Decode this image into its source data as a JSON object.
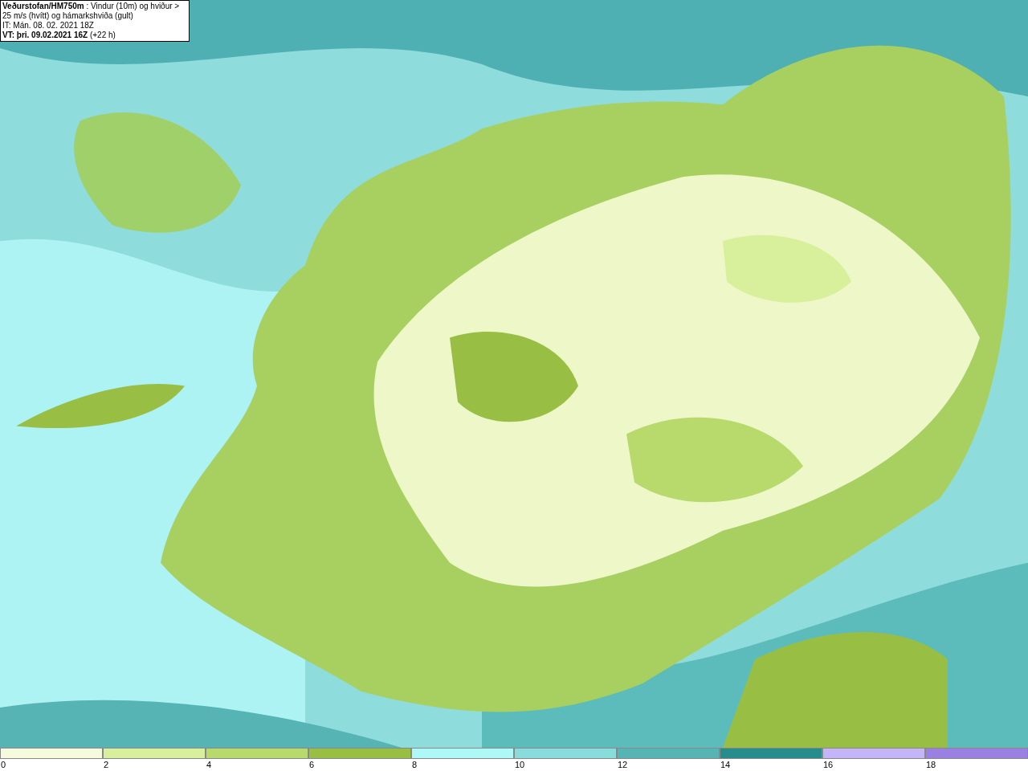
{
  "caption": {
    "heading": "**Veðurstofan/HM750m** : Vindur (10m) og hviður > 25 m/s (hvítt) og hámarkshviða (gult)",
    "initial_time": "IT: Mán. 08. 02. 2021 18Z",
    "valid_time": "**VT: þri. 09.02.2021 16Z** (+22 h)"
  },
  "legend": {
    "bins": [
      {
        "color": "#f5fbdc"
      },
      {
        "color": "#d8ef9c"
      },
      {
        "color": "#b8d96c"
      },
      {
        "color": "#98bf44"
      },
      {
        "color": "#aef8f8"
      },
      {
        "color": "#88dcdc"
      },
      {
        "color": "#56b4b4"
      },
      {
        "color": "#268c8c"
      },
      {
        "color": "#c4b4f8"
      },
      {
        "color": "#9a80e0"
      }
    ],
    "ticks": [
      "0",
      "2",
      "4",
      "6",
      "8",
      "10",
      "12",
      "14",
      "16",
      "18"
    ]
  }
}
